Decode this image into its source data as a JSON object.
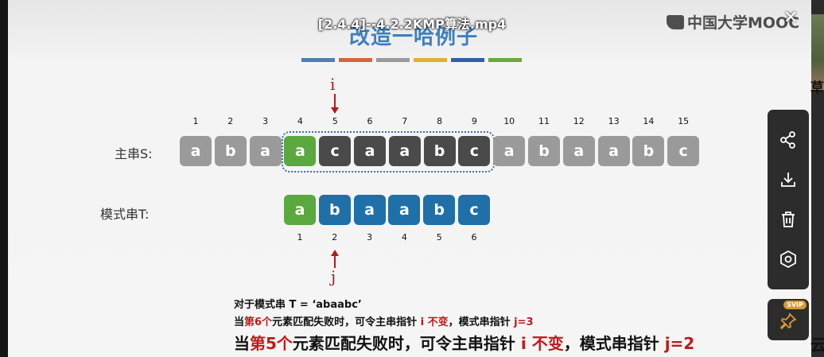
{
  "video": {
    "title": "[2.4.4]--4.2.2KMP算法.mp4",
    "logo_text": "中国大学MOOC",
    "close": "✕"
  },
  "slide": {
    "title": "改造一哈例子",
    "color_bars": [
      "#4f7fb0",
      "#d2663d",
      "#9a9a9a",
      "#e0b030",
      "#2f5fa8",
      "#6aaa3a"
    ],
    "main_label": "主串S:",
    "pattern_label": "模式串T:",
    "main_indices": [
      "1",
      "2",
      "3",
      "4",
      "5",
      "6",
      "7",
      "8",
      "9",
      "10",
      "11",
      "12",
      "13",
      "14",
      "15"
    ],
    "main_chars": [
      "a",
      "b",
      "a",
      "a",
      "c",
      "a",
      "a",
      "b",
      "c",
      "a",
      "b",
      "a",
      "a",
      "b",
      "c"
    ],
    "main_states": [
      "gray",
      "gray",
      "gray",
      "green",
      "dark",
      "dark",
      "dark",
      "dark",
      "dark",
      "gray",
      "gray",
      "gray",
      "gray",
      "gray",
      "gray"
    ],
    "pattern_indices": [
      "1",
      "2",
      "3",
      "4",
      "5",
      "6"
    ],
    "pattern_chars": [
      "a",
      "b",
      "a",
      "a",
      "b",
      "c"
    ],
    "pattern_states": [
      "green",
      "blue",
      "blue",
      "blue",
      "blue",
      "blue"
    ],
    "state_colors": {
      "gray": "#9a9a9a",
      "green": "#5aa83e",
      "dark": "#4a4a4a",
      "blue": "#1f6fa8"
    },
    "pointer_i": "i",
    "pointer_j": "j",
    "caption1": "对于模式串 T = ‘abaabc’",
    "caption2": {
      "p1": "当",
      "p2": "第6个",
      "p3": "元素匹配失败时，可令主串指针 ",
      "p4": "i 不变",
      "p5": "，模式串指针 ",
      "p6": "j=3"
    },
    "caption3": {
      "p1": "当",
      "p2": "第5个",
      "p3": "元素匹配失败时，可令主串指针 ",
      "p4": "i 不变",
      "p5": "，模式串指针 ",
      "p6": "j=2"
    }
  },
  "side": {
    "strip_text_top": "草",
    "strip_text_bottom": "云"
  },
  "toolbar": {
    "icons": [
      "share-icon",
      "download-icon",
      "delete-icon",
      "view-icon"
    ],
    "svip_badge": "SVIP"
  }
}
